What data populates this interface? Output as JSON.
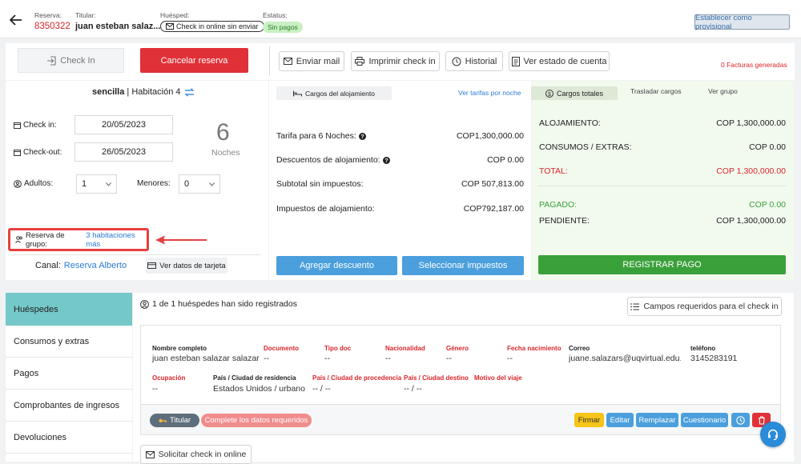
{
  "header": {
    "reserva_label": "Reserva:",
    "reserva_num": "8350322",
    "titular_label": "Titular:",
    "titular_name": "juan esteban salaz...",
    "huesped_label": "Huésped:",
    "checkin_online": "Check in online sin enviar",
    "estatus_label": "Estatus:",
    "estatus_value": "Sin pagos",
    "provisional_btn": "Establecer como provisional"
  },
  "actions": {
    "checkin": "Check In",
    "cancelar": "Cancelar reserva",
    "enviar_mail": "Enviar mail",
    "imprimir": "Imprimir check in",
    "historial": "Historial",
    "estado_cuenta": "Ver estado de cuenta",
    "facturas": "0 Facturas generadas"
  },
  "room": {
    "type": "sencilla",
    "sep": " | ",
    "habitacion": "Habitación 4",
    "checkin_label": "Check in:",
    "checkin_date": "20/05/2023",
    "checkout_label": "Check-out:",
    "checkout_date": "26/05/2023",
    "nights": "6",
    "nights_label": "Noches",
    "adultos_label": "Adultos:",
    "adultos": "1",
    "menores_label": "Menores:",
    "menores": "0",
    "grupo_label": "Reserva de grupo:",
    "grupo_link": "3 habitaciones más",
    "canal_label": "Canal:",
    "canal_value": "Reserva Alberto",
    "tarjeta_btn": "Ver datos de tarjeta"
  },
  "charges": {
    "tab_cargos": "Cargos del alojamiento",
    "tarifas_link": "Ver tarifas por noche",
    "tarifa_label": "Tarifa para 6 Noches:",
    "tarifa_value": "COP1,300,000.00",
    "descuentos_label": "Descuentos de alojamiento:",
    "descuentos_value": "COP 0.00",
    "subtotal_label": "Subtotal sin impuestos:",
    "subtotal_value": "COP 507,813.00",
    "impuestos_label": "Impuestos de alojamiento:",
    "impuestos_value": "COP792,187.00",
    "agregar_desc": "Agregar descuento",
    "sel_impuestos": "Seleccionar impuestos"
  },
  "totals": {
    "tab_totales": "Cargos totales",
    "tab_trasladar": "Trasladar cargos",
    "tab_grupo": "Ver grupo",
    "aloj_label": "ALOJAMIENTO:",
    "aloj_value": "COP 1,300,000.00",
    "consumos_label": "CONSUMOS / EXTRAS:",
    "consumos_value": "COP 0.00",
    "total_label": "TOTAL:",
    "total_value": "COP 1,300,000.00",
    "pagado_label": "PAGADO:",
    "pagado_value": "COP 0.00",
    "pendiente_label": "PENDIENTE:",
    "pendiente_value": "COP 1,300,000.00",
    "registrar": "REGISTRAR PAGO"
  },
  "sidebar": {
    "items": [
      {
        "label": "Huéspedes"
      },
      {
        "label": "Consumos y extras"
      },
      {
        "label": "Pagos"
      },
      {
        "label": "Comprobantes de ingresos"
      },
      {
        "label": "Devoluciones"
      }
    ]
  },
  "guests": {
    "registered": "1 de 1 huéspedes han sido registrados",
    "campos_btn": "Campos requeridos para el check in",
    "h_nombre": "Nombre completo",
    "v_nombre": "juan esteban salazar salazar",
    "h_documento": "Documento",
    "v_documento": "--",
    "h_tipo": "Tipo doc",
    "v_tipo": "--",
    "h_nacionalidad": "Nacionalidad",
    "v_nacionalidad": "--",
    "h_genero": "Género",
    "v_genero": "--",
    "h_fecha": "Fecha nacimiento",
    "v_fecha": "--",
    "h_correo": "Correo",
    "v_correo": "juane.salazars@uqvirtual.edu.c",
    "h_telefono": "teléfono",
    "v_telefono": "3145283191",
    "h_ocupacion": "Ocupación",
    "v_ocupacion": "--",
    "h_residencia": "País / Ciudad de residencia",
    "v_residencia": "Estados Unidos / urbano",
    "h_procedencia": "País / Ciudad de procedencia",
    "v_procedencia": "-- / --",
    "h_destino": "País / Ciudad destino",
    "v_destino": "-- / --",
    "h_motivo": "Motivo del viaje",
    "titular_badge": "Titular",
    "complete_badge": "Complete los datos requeridos",
    "firmar": "Firmar",
    "editar": "Editar",
    "remplazar": "Remplazar",
    "cuestionario": "Cuestionario",
    "solicitar": "Solicitar check in online"
  },
  "colors": {
    "red": "#d9262b",
    "green": "#3aa13a",
    "blue": "#4a9fdc",
    "teal": "#75c8c9",
    "yellow": "#f5c518"
  }
}
